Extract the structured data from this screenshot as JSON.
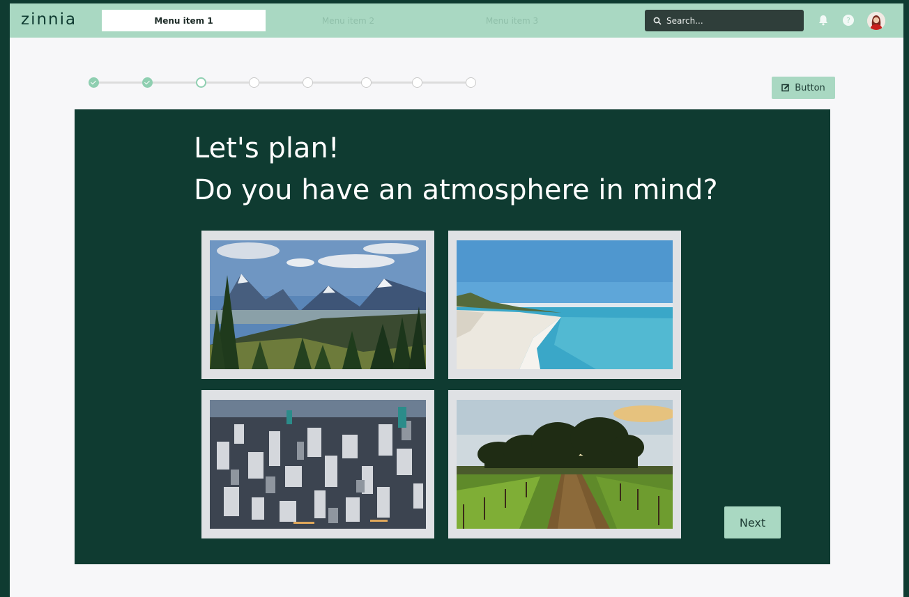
{
  "app": {
    "logo": "zinnia",
    "nav": [
      {
        "label": "Menu item 1",
        "active": true
      },
      {
        "label": "Menu item 2",
        "active": false
      },
      {
        "label": "Menu item 3",
        "active": false
      }
    ],
    "search_placeholder": "Search..."
  },
  "stepper": {
    "total_steps": 8,
    "completed_steps": 2,
    "current_step": 3
  },
  "toolbar": {
    "button_label": "Button"
  },
  "main": {
    "title_line1": "Let's plan!",
    "title_line2": "Do you have an atmosphere in mind?",
    "options": [
      {
        "name": "mountains",
        "image": "mountain landscape with pine forest"
      },
      {
        "name": "beach",
        "image": "sandy beach with turquoise sea"
      },
      {
        "name": "city",
        "image": "aerial view of city skyscrapers"
      },
      {
        "name": "countryside",
        "image": "sunset over trees and green field"
      }
    ],
    "next_label": "Next"
  },
  "colors": {
    "accent": "#a9d8c2",
    "panel": "#0f3b31",
    "background": "#f7f7f9"
  }
}
